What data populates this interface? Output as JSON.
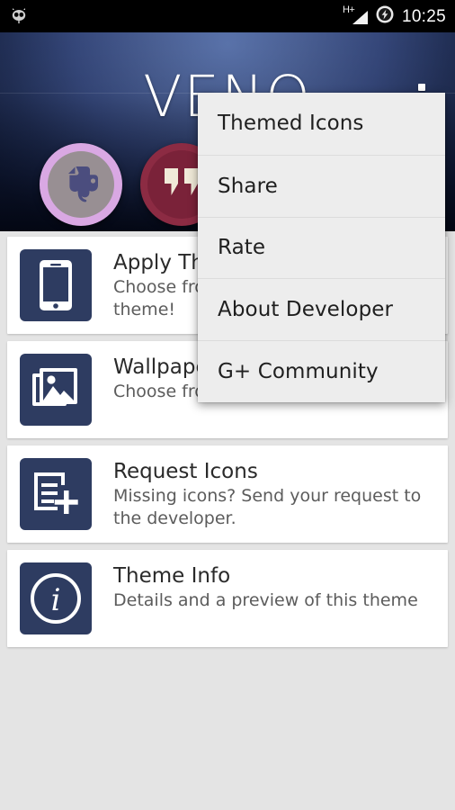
{
  "status_bar": {
    "notification_icon": "cyanogenmod-skull-icon",
    "network_type": "H+",
    "signal_icon": "signal-bars-icon",
    "battery_icon": "battery-charging-icon",
    "time": "10:25"
  },
  "header": {
    "app_title": "VENO",
    "overflow_icon": "overflow-menu-icon",
    "preview_icons": [
      {
        "name": "evernote-icon",
        "ring_color": "#d9a8e3",
        "inner_color": "#988f93",
        "glyph_color": "#4b4d7e"
      },
      {
        "name": "hangouts-icon",
        "ring_color": "#8c2b43",
        "inner_color": "#7a2239",
        "glyph_color": "#f0ead8"
      }
    ]
  },
  "cards": [
    {
      "icon": "phone-device-icon",
      "title": "Apply Theme",
      "subtitle": "Choose from a launcher to apply this theme!"
    },
    {
      "icon": "wallpaper-gallery-icon",
      "title": "Wallpapers",
      "subtitle": "Choose from a list of wallpapers"
    },
    {
      "icon": "request-icons-icon",
      "title": "Request Icons",
      "subtitle": "Missing icons? Send your request to the developer."
    },
    {
      "icon": "info-circle-icon",
      "title": "Theme Info",
      "subtitle": "Details and a preview of this theme"
    }
  ],
  "overflow_menu": {
    "items": [
      {
        "label": "Themed Icons"
      },
      {
        "label": "Share"
      },
      {
        "label": "Rate"
      },
      {
        "label": "About Developer"
      },
      {
        "label": "G+ Community"
      }
    ]
  },
  "colors": {
    "accent_navy": "#2e3c61",
    "header_blue": "#4a5f93",
    "page_background": "#e4e4e4",
    "card_background": "#ffffff",
    "menu_background": "#ededed"
  }
}
